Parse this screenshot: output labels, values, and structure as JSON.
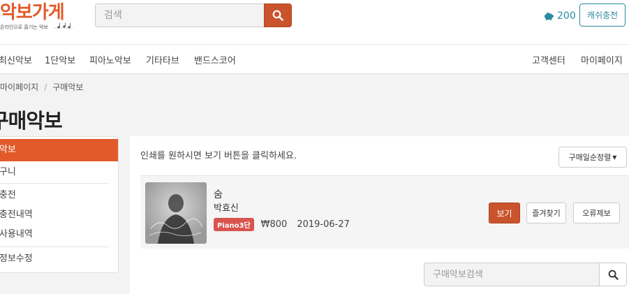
{
  "header": {
    "logo_title": "악보가게",
    "logo_subtitle": "온라인으로 즐기는 악보",
    "search_placeholder": "검색",
    "points": "200",
    "charge_label": "캐쉬충전"
  },
  "nav": {
    "left": [
      "최신악보",
      "1단악보",
      "피아노악보",
      "기타타브",
      "밴드스코어"
    ],
    "right": [
      "고객센터",
      "마이페이지"
    ]
  },
  "breadcrumb": [
    "마이페이지",
    "구매악보"
  ],
  "page_title": "구매악보",
  "sidebar": {
    "items": [
      {
        "label": "구매악보",
        "active": true
      },
      {
        "label": "장바구니"
      },
      {
        "label": "캐쉬충전"
      },
      {
        "label": "캐쉬충전내역"
      },
      {
        "label": "캐쉬사용내역"
      },
      {
        "label": "회원정보수정"
      }
    ]
  },
  "main": {
    "notice": "인쇄를 원하시면 보기 버튼을 클릭하세요.",
    "sort_label": "구매일순정렬",
    "purchases": [
      {
        "title": "숨",
        "artist": "박효신",
        "level": "Piano3단",
        "price": "₩800",
        "date": "2019-06-27",
        "view_label": "보기",
        "like_label": "즐겨찾기",
        "report_label": "오류제보"
      }
    ],
    "bottom_search_placeholder": "구매악보검색"
  },
  "colors": {
    "accent": "#e25a2a",
    "button": "#c9542c",
    "teal": "#2a8aa0",
    "badge": "#d9534f"
  }
}
